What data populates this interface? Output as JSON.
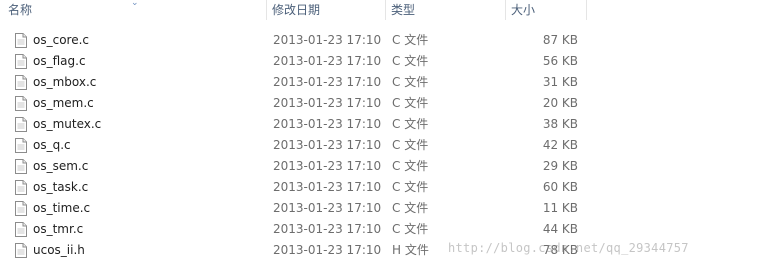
{
  "columns": {
    "name": "名称",
    "date": "修改日期",
    "type": "类型",
    "size": "大小"
  },
  "files": [
    {
      "name": "os_core.c",
      "date": "2013-01-23 17:10",
      "type": "C 文件",
      "size": "87 KB"
    },
    {
      "name": "os_flag.c",
      "date": "2013-01-23 17:10",
      "type": "C 文件",
      "size": "56 KB"
    },
    {
      "name": "os_mbox.c",
      "date": "2013-01-23 17:10",
      "type": "C 文件",
      "size": "31 KB"
    },
    {
      "name": "os_mem.c",
      "date": "2013-01-23 17:10",
      "type": "C 文件",
      "size": "20 KB"
    },
    {
      "name": "os_mutex.c",
      "date": "2013-01-23 17:10",
      "type": "C 文件",
      "size": "38 KB"
    },
    {
      "name": "os_q.c",
      "date": "2013-01-23 17:10",
      "type": "C 文件",
      "size": "42 KB"
    },
    {
      "name": "os_sem.c",
      "date": "2013-01-23 17:10",
      "type": "C 文件",
      "size": "29 KB"
    },
    {
      "name": "os_task.c",
      "date": "2013-01-23 17:10",
      "type": "C 文件",
      "size": "60 KB"
    },
    {
      "name": "os_time.c",
      "date": "2013-01-23 17:10",
      "type": "C 文件",
      "size": "11 KB"
    },
    {
      "name": "os_tmr.c",
      "date": "2013-01-23 17:10",
      "type": "C 文件",
      "size": "44 KB"
    },
    {
      "name": "ucos_ii.h",
      "date": "2013-01-23 17:10",
      "type": "H 文件",
      "size": "78 KB"
    }
  ],
  "watermark": "http://blog.csdn.net/qq_29344757",
  "icons": {
    "file": "document-icon",
    "sort": "sort-caret-icon"
  }
}
